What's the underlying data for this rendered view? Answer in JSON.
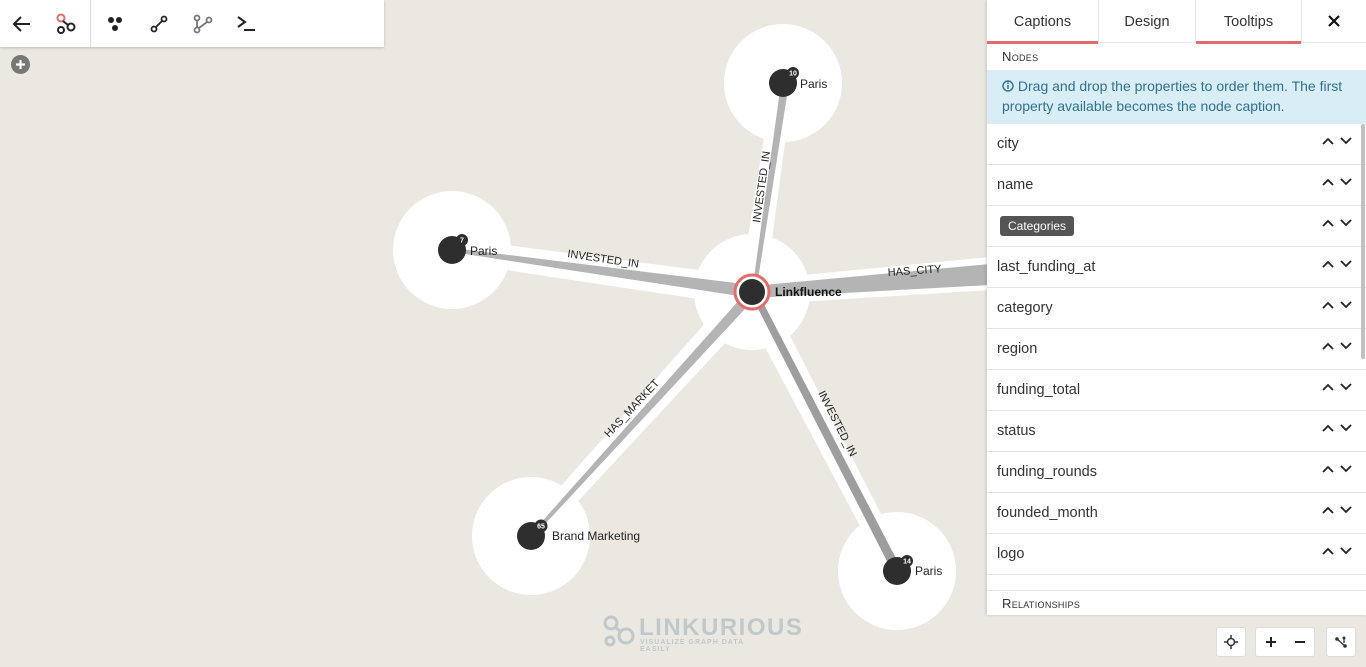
{
  "toolbar": {
    "items": [
      "back-arrow-icon",
      "graph-icon",
      "nodes-icon",
      "edge-icon",
      "path-icon",
      "terminal-icon"
    ]
  },
  "graph": {
    "center_label": "Linkfluence",
    "nodes": [
      {
        "label": "Paris",
        "badge": "10"
      },
      {
        "label": "Paris",
        "badge": "7"
      },
      {
        "label": "Brand Marketing",
        "badge": "65"
      },
      {
        "label": "Paris",
        "badge": "14"
      }
    ],
    "edges": [
      "INVESTED_IN",
      "INVESTED_IN",
      "HAS_CITY",
      "HAS_MARKET",
      "INVESTED_IN"
    ]
  },
  "panel": {
    "tabs": [
      "Captions",
      "Design",
      "Tooltips"
    ],
    "nodes_title": "Nodes",
    "info": "Drag and drop the properties to order them. The first property available becomes the node caption.",
    "properties": [
      "city",
      "name",
      "Categories",
      "last_funding_at",
      "category",
      "region",
      "funding_total",
      "status",
      "funding_rounds",
      "founded_month",
      "logo"
    ],
    "relationships_title": "Relationships"
  },
  "watermark": {
    "brand": "LINKURIOUS",
    "tagline": "VISUALIZE GRAPH DATA EASILY"
  },
  "colors": {
    "accent": "#e46b6b",
    "node": "#2e2e2e",
    "edge": "#b4b4b4",
    "info_bg": "#d9edf7"
  }
}
